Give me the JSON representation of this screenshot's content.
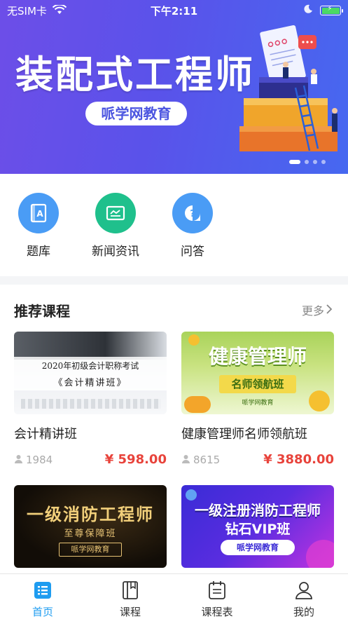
{
  "status_bar": {
    "carrier": "无SIM卡",
    "time": "下午2:11"
  },
  "banner": {
    "title": "装配式工程师",
    "brand": "哌学网教育",
    "page_count": 4,
    "active_page": 1
  },
  "quick_entries": [
    {
      "label": "题库",
      "icon": "question-bank-icon",
      "color": "#4a9cf5"
    },
    {
      "label": "新闻资讯",
      "icon": "news-icon",
      "color": "#1fc08c"
    },
    {
      "label": "问答",
      "icon": "qa-icon",
      "color": "#4a9cf5"
    }
  ],
  "recommend": {
    "title": "推荐课程",
    "more": "更多",
    "courses": [
      {
        "name": "会计精讲班",
        "students": "1984",
        "price": "¥ 598.00",
        "thumb": {
          "line1": "2020年初级会计职称考试",
          "line2": "《会计精讲班》"
        }
      },
      {
        "name": "健康管理师名师领航班",
        "students": "8615",
        "price": "¥ 3880.00",
        "thumb": {
          "line1": "健康管理师",
          "line2": "名师领航班",
          "line3": "哌学网教育"
        }
      },
      {
        "name": "",
        "students": "",
        "price": "",
        "thumb": {
          "line1": "一级消防工程师",
          "line2": "至尊保障班",
          "line3": "哌学网教育"
        }
      },
      {
        "name": "",
        "students": "",
        "price": "",
        "thumb": {
          "line1": "一级注册消防工程师",
          "line2": "钻石VIP班",
          "line3": "哌学网教育"
        }
      }
    ]
  },
  "tabbar": {
    "items": [
      {
        "label": "首页",
        "icon": "home-grid-icon"
      },
      {
        "label": "课程",
        "icon": "book-icon"
      },
      {
        "label": "课程表",
        "icon": "schedule-icon"
      },
      {
        "label": "我的",
        "icon": "profile-icon"
      }
    ],
    "active_index": 0,
    "active_color": "#1e9cf0"
  }
}
